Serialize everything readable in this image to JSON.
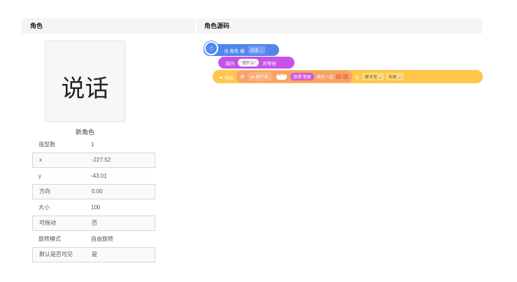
{
  "left_panel": {
    "header": "角色"
  },
  "right_panel": {
    "header": "角色源码"
  },
  "sprite": {
    "preview_text": "说话",
    "name": "新角色"
  },
  "properties": [
    {
      "key": "造型数",
      "value": "1"
    },
    {
      "key": "x",
      "value": "-227.52"
    },
    {
      "key": "y",
      "value": "-43.01"
    },
    {
      "key": "方向",
      "value": "0.00"
    },
    {
      "key": "大小",
      "value": "100"
    },
    {
      "key": "可拖动",
      "value": "否"
    },
    {
      "key": "旋转模式",
      "value": "自由旋转"
    },
    {
      "key": "默认是否可见",
      "value": "是"
    }
  ],
  "blocks": {
    "event": {
      "prefix": "当 角色 被",
      "dropdown": "点击 ⌄"
    },
    "ask": {
      "prefix": "询问",
      "string": "\"说什么\"",
      "suffix": "并等待"
    },
    "add": {
      "prefix": "添加",
      "join_label": "把",
      "username_label": "用户名",
      "sep_string": "\": \"",
      "answer_label": "获得 答复",
      "together_label": "放在一起",
      "to_label": "到",
      "list_dropdown": "聊天室 ⌄",
      "position_dropdown": "末尾 ⌄"
    }
  }
}
